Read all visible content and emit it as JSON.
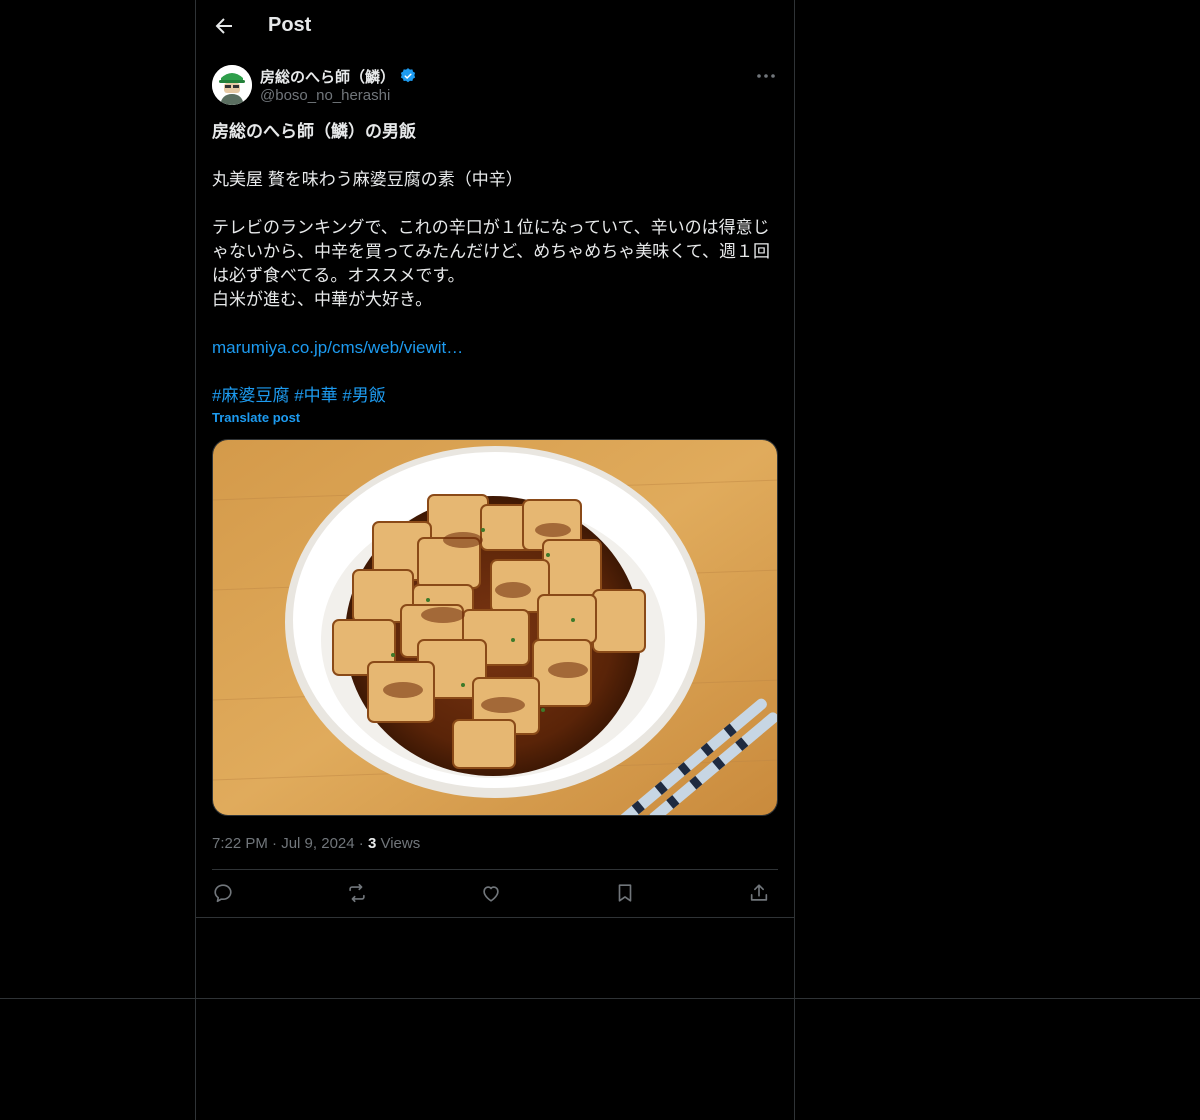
{
  "header": {
    "title": "Post"
  },
  "author": {
    "name": "房総のへら師（鱗）",
    "handle": "@boso_no_herashi"
  },
  "post": {
    "title_line": "房総のへら師（鱗）の男飯",
    "product_line": "丸美屋 贅を味わう麻婆豆腐の素（中辛）",
    "paragraph_1": "テレビのランキングで、これの辛口が１位になっていて、辛いのは得意じゃないから、中辛を買ってみたんだけど、めちゃめちゃ美味くて、週１回は必ず食べてる。オススメです。",
    "paragraph_2": "白米が進む、中華が大好き。",
    "link_text": "marumiya.co.jp/cms/web/viewit…",
    "hashtags": [
      "#麻婆豆腐",
      "#中華",
      "#男飯"
    ],
    "translate_label": "Translate post"
  },
  "meta": {
    "time": "7:22 PM",
    "separator": "·",
    "date": "Jul 9, 2024",
    "views_count": "3",
    "views_label": "Views"
  },
  "icons": {
    "back": "arrow-left-icon",
    "verified": "verified-badge-icon",
    "more": "more-icon",
    "reply": "reply-icon",
    "repost": "repost-icon",
    "like": "like-icon",
    "bookmark": "bookmark-icon",
    "share": "share-icon"
  },
  "colors": {
    "background": "#000000",
    "text": "#e7e9ea",
    "muted": "#71767b",
    "accent": "#1d9bf0",
    "border": "#2f3336"
  }
}
